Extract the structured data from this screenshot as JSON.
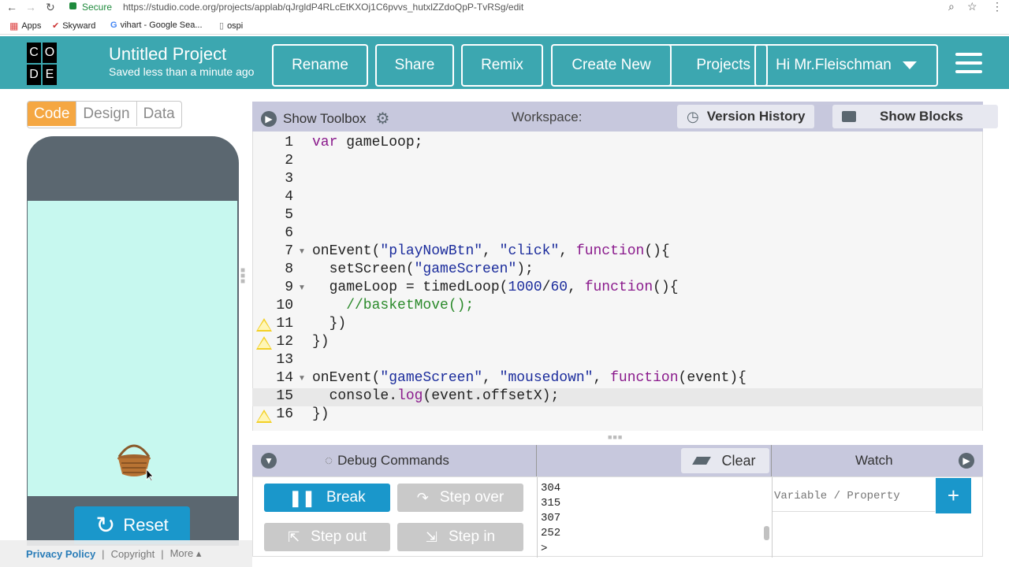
{
  "browser": {
    "secure_label": "Secure",
    "url": "https://studio.code.org/projects/applab/qJrgldP4RLcEtKXOj1C6pvvs_hutxlZZdoQpP-TvRSg/edit",
    "bookmarks": [
      "Apps",
      "Skyward",
      "vihart - Google Sea...",
      "ospi"
    ]
  },
  "header": {
    "logo_letters": [
      "C",
      "O",
      "D",
      "E"
    ],
    "project_title": "Untitled Project",
    "saved_status": "Saved less than a minute ago",
    "buttons": {
      "rename": "Rename",
      "share": "Share",
      "remix": "Remix",
      "create_new": "Create New",
      "projects": "Projects",
      "user": "Hi Mr.Fleischman"
    }
  },
  "left_panel": {
    "tabs": [
      "Code",
      "Design",
      "Data"
    ],
    "active_tab": "Code",
    "reset_label": "Reset",
    "footer": {
      "privacy": "Privacy Policy",
      "sep": "|",
      "copyright": "Copyright",
      "more": "More ▴"
    }
  },
  "editor": {
    "show_toolbox": "Show Toolbox",
    "workspace_label": "Workspace:",
    "version_history": "Version History",
    "show_blocks": "Show Blocks",
    "line_numbers": [
      "1",
      "2",
      "3",
      "4",
      "5",
      "6",
      "7",
      "8",
      "9",
      "10",
      "11",
      "12",
      "13",
      "14",
      "15",
      "16"
    ]
  },
  "debug": {
    "title": "Debug Commands",
    "clear": "Clear",
    "watch": "Watch",
    "break": "Break",
    "step_over": "Step over",
    "step_out": "Step out",
    "step_in": "Step in",
    "console_lines": [
      "304",
      "315",
      "307",
      "252"
    ],
    "prompt": ">",
    "watch_placeholder": "Variable / Property",
    "add": "+"
  },
  "colors": {
    "header_bg": "#3ca7b0",
    "active_tab": "#f5a742",
    "app_screen": "#c7f8ef",
    "toolbar_bg": "#c7c8dd",
    "primary_button": "#1a97cb"
  }
}
